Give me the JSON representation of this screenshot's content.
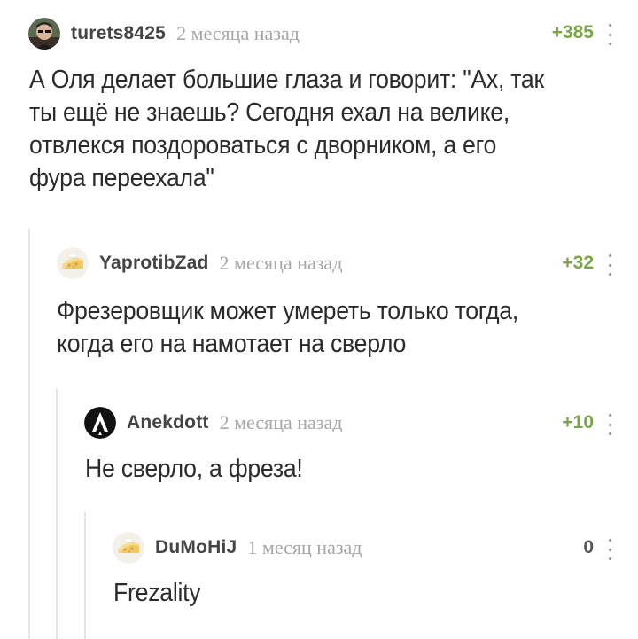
{
  "comments": [
    {
      "username": "turets8425",
      "timestamp": "2 месяца назад",
      "rating": "+385",
      "text": "А Оля делает большие глаза и говорит: \"Ах, так\nты ещё не знаешь? Сегодня ехал на велике,\nотвлекся поздороваться с дворником, а его\nфура переехала\"",
      "avatar": "user-photo"
    },
    {
      "username": "YaprotibZad",
      "timestamp": "2 месяца назад",
      "rating": "+32",
      "text": "Фрезеровщик может умереть только тогда,\nкогда его на намотает на сверло",
      "avatar": "cheese-avatar"
    },
    {
      "username": "Anekdott",
      "timestamp": "2 месяца назад",
      "rating": "+10",
      "text": "Не сверло, а фреза!",
      "avatar": "rocket-logo"
    },
    {
      "username": "DuMoHiJ",
      "timestamp": "1 месяц назад",
      "rating": "0",
      "text": "Frezality",
      "avatar": "cheese-avatar"
    }
  ],
  "colors": {
    "positive_rating": "#7aa447",
    "neutral_rating": "#555555",
    "timestamp": "#a7a7a7",
    "thread_line": "#e6e6e6"
  }
}
